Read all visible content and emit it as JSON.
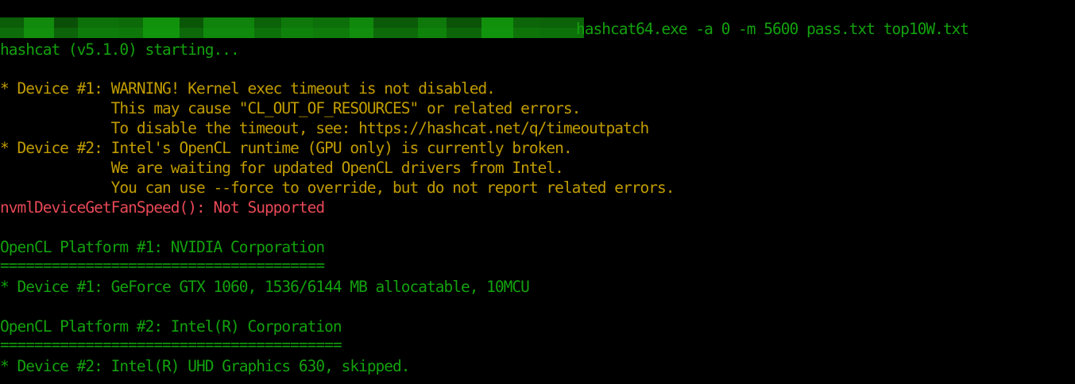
{
  "colors": {
    "background": "#000000",
    "green": "#13a10e",
    "yellow": "#c19c00",
    "red": "#e74856"
  },
  "command_line": {
    "command": "hashcat64.exe -a 0 -m 5600 pass.txt top10W.txt"
  },
  "lines": {
    "starting": "hashcat (v5.1.0) starting...",
    "warn1_a": "* Device #1: WARNING! Kernel exec timeout is not disabled.",
    "warn1_b": "             This may cause \"CL_OUT_OF_RESOURCES\" or related errors.",
    "warn1_c": "             To disable the timeout, see: https://hashcat.net/q/timeoutpatch",
    "warn2_a": "* Device #2: Intel's OpenCL runtime (GPU only) is currently broken.",
    "warn2_b": "             We are waiting for updated OpenCL drivers from Intel.",
    "warn2_c": "             You can use --force to override, but do not report related errors.",
    "fan_error": "nvmlDeviceGetFanSpeed(): Not Supported",
    "platform1_title": "OpenCL Platform #1: NVIDIA Corporation",
    "platform1_rule": "======================================",
    "platform1_device": "* Device #1: GeForce GTX 1060, 1536/6144 MB allocatable, 10MCU",
    "platform2_title": "OpenCL Platform #2: Intel(R) Corporation",
    "platform2_rule": "========================================",
    "platform2_device": "* Device #2: Intel(R) UHD Graphics 630, skipped."
  }
}
